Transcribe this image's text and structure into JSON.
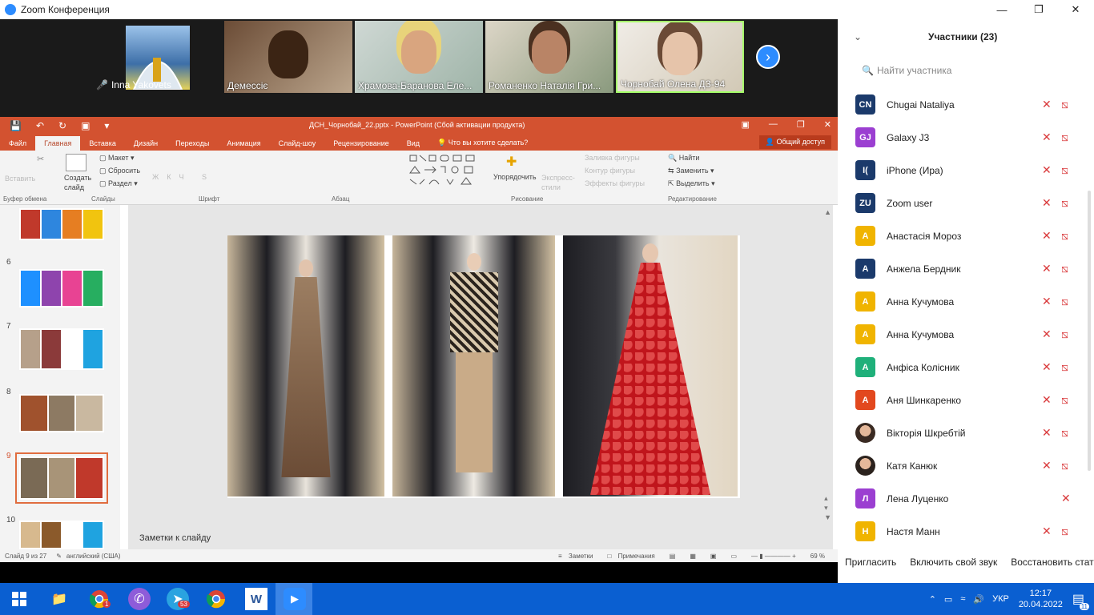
{
  "zoom": {
    "title": "Zoom Конференция",
    "gallery": [
      {
        "name": "Inna Yakovets"
      },
      {
        "name": "Демессіє"
      },
      {
        "name": "Храмова-Баранова Еле..."
      },
      {
        "name": "Романенко Наталія Гри..."
      },
      {
        "name": "Чорнобай Олена ДЗ-94"
      }
    ]
  },
  "ppt": {
    "title": "ДСН_Чорнобай_22.pptx - PowerPoint (Сбой активации продукта)",
    "tabs": [
      "Файл",
      "Главная",
      "Вставка",
      "Дизайн",
      "Переходы",
      "Анимация",
      "Слайд-шоу",
      "Рецензирование",
      "Вид"
    ],
    "tell_me": "Что вы хотите сделать?",
    "share": "Общий доступ",
    "ribbon": {
      "paste": "Вставить",
      "new_slide": "Создать слайд",
      "layout": "Макет",
      "reset": "Сбросить",
      "section": "Раздел",
      "arrange": "Упорядочить",
      "express_styles": "Экспресс-стили",
      "shape_fill": "Заливка фигуры",
      "shape_outline": "Контур фигуры",
      "shape_effects": "Эффекты фигуры",
      "find": "Найти",
      "replace": "Заменить",
      "select": "Выделить",
      "groups": [
        "Буфер обмена",
        "Слайды",
        "Шрифт",
        "Абзац",
        "Рисование",
        "Редактирование"
      ]
    },
    "thumbnails": [
      {
        "num": "6"
      },
      {
        "num": "7"
      },
      {
        "num": "8"
      },
      {
        "num": "9"
      },
      {
        "num": "10"
      }
    ],
    "notes_label": "Заметки к слайду",
    "status": {
      "slide": "Слайд 9 из 27",
      "language": "английский (США)",
      "notes": "Заметки",
      "comments": "Примечания",
      "zoom": "69 %"
    }
  },
  "participants": {
    "title": "Участники (23)",
    "search_placeholder": "Найти участника",
    "list": [
      {
        "initials": "CN",
        "name": "Chugai Nataliya",
        "color": "#1b3a6b",
        "cam_off": true
      },
      {
        "initials": "GJ",
        "name": "Galaxy J3",
        "color": "#9b3fd1",
        "cam_off": true
      },
      {
        "initials": "I(",
        "name": "iPhone (Ира)",
        "color": "#1b3a6b",
        "cam_off": true
      },
      {
        "initials": "ZU",
        "name": "Zoom user",
        "color": "#1b3a6b",
        "cam_off": true
      },
      {
        "initials": "A",
        "name": "Анастасія Мороз",
        "color": "#f0b400",
        "cam_off": true
      },
      {
        "initials": "A",
        "name": "Анжела Бердник",
        "color": "#1b3a6b",
        "cam_off": true
      },
      {
        "initials": "A",
        "name": "Анна Кучумова",
        "color": "#f0b400",
        "cam_off": true
      },
      {
        "initials": "A",
        "name": "Анна Кучумова",
        "color": "#f0b400",
        "cam_off": true
      },
      {
        "initials": "A",
        "name": "Анфіса Колісник",
        "color": "#1fb07a",
        "cam_off": true
      },
      {
        "initials": "A",
        "name": "Аня Шинкаренко",
        "color": "#e2481e",
        "cam_off": true
      },
      {
        "initials": "",
        "name": "Вікторія Шкребтій",
        "color": "#3a2a22",
        "cam_off": true
      },
      {
        "initials": "",
        "name": "Катя Канюк",
        "color": "#2b221d",
        "cam_off": true
      },
      {
        "initials": "Л",
        "name": "Лена Луценко",
        "color": "#9b3fd1",
        "cam_off": false
      },
      {
        "initials": "H",
        "name": "Настя Манн",
        "color": "#f0b400",
        "cam_off": true
      }
    ],
    "footer": {
      "invite": "Пригласить",
      "unmute": "Включить свой звук",
      "restore": "Восстановить стату"
    }
  },
  "taskbar": {
    "language": "УКР",
    "time": "12:17",
    "date": "20.04.2022",
    "chrome_badge": "1",
    "telegram_badge": "53",
    "notification_count": "11"
  }
}
